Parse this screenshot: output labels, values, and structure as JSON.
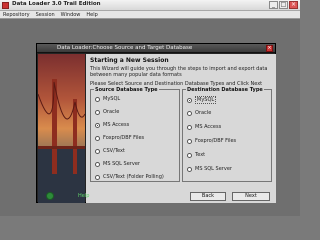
{
  "window": {
    "title": "Data Loader 3.0 Trail Edition",
    "min_label": "_",
    "max_label": "□",
    "close_label": "×"
  },
  "menu": [
    "Repository",
    "Session",
    "Window",
    "Help"
  ],
  "dialog": {
    "title": "Data Loader:Choose Source and Target Database",
    "close_label": "×",
    "heading": "Starting a New Session",
    "description": "This Wizard will guide you through the steps to import and export data between many popular data formats",
    "instruction": "Please Select Source and Destination Database Types and Click Next",
    "source": {
      "legend": "Source Database Type",
      "options": [
        "MySQL",
        "Oracle",
        "MS Access",
        "Foxpro/DBF Files",
        "CSV/Text",
        "MS SQL Server",
        "CSV/Text (Folder Polling)"
      ],
      "selected": "MS Access"
    },
    "destination": {
      "legend": "Destination Database Type",
      "options": [
        "MySQL",
        "Oracle",
        "MS Access",
        "Foxpro/DBF Files",
        "Text",
        "MS SQL Server"
      ],
      "selected": "MySQL"
    },
    "buttons": {
      "help": "Help",
      "back": "Back",
      "next": "Next"
    }
  },
  "colors": {
    "dialog_bg": "#242424",
    "content_bg": "#d8d8d8",
    "help_green": "#2e8b3a"
  }
}
